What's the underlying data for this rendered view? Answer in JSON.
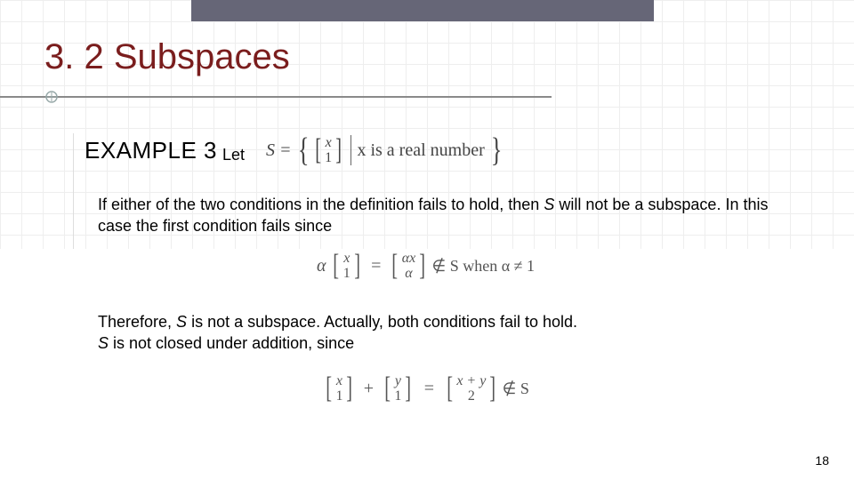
{
  "slide": {
    "title": "3. 2 Subspaces",
    "page_number": "18",
    "example_label": "EXAMPLE 3",
    "let_word": "Let",
    "set_def": {
      "S_equals": "S =",
      "vec_top": "x",
      "vec_bot": "1",
      "condition": "x is a real number"
    },
    "para1_a": "If either of the two conditions in the definition fails to hold, then ",
    "para1_s": "S",
    "para1_b": " will not be a subspace.  In this case the first condition fails since",
    "math1": {
      "alpha": "α",
      "vec1_top": "x",
      "vec1_bot": "1",
      "eq": "=",
      "vec2_top": "αx",
      "vec2_bot": "α",
      "tail": " ∉ S  when α ≠ 1"
    },
    "para2_a": "Therefore, ",
    "para2_s1": "S",
    "para2_b": " is not a subspace. Actually, both conditions fail to hold. ",
    "para2_s2": "S",
    "para2_c": " is not closed under addition, since",
    "math2": {
      "vec1_top": "x",
      "vec1_bot": "1",
      "plus": "+",
      "vec2_top": "y",
      "vec2_bot": "1",
      "eq": "=",
      "vec3_top": "x + y",
      "vec3_bot": "2",
      "tail": " ∉ S"
    }
  }
}
